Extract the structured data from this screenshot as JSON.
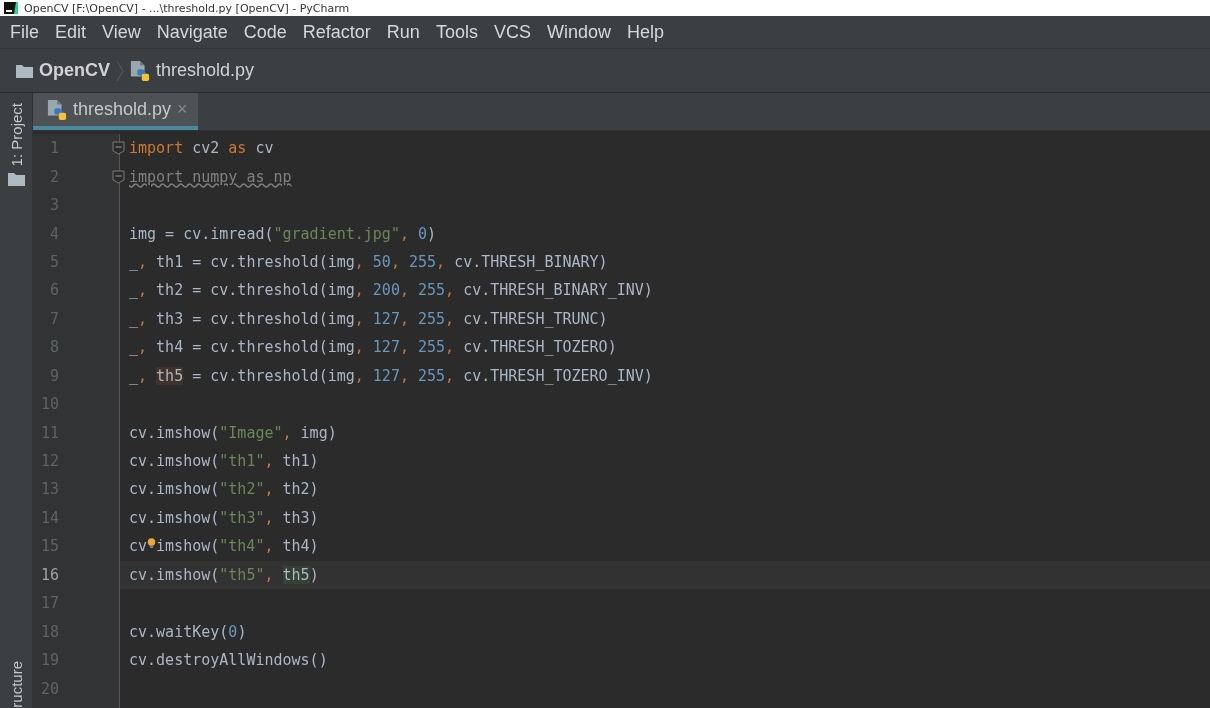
{
  "window": {
    "title": "OpenCV [F:\\OpenCV] - ...\\threshold.py [OpenCV] - PyCharm"
  },
  "menu": [
    {
      "label": "File"
    },
    {
      "label": "Edit"
    },
    {
      "label": "View"
    },
    {
      "label": "Navigate"
    },
    {
      "label": "Code"
    },
    {
      "label": "Refactor"
    },
    {
      "label": "Run"
    },
    {
      "label": "Tools"
    },
    {
      "label": "VCS"
    },
    {
      "label": "Window"
    },
    {
      "label": "Help"
    }
  ],
  "breadcrumb": [
    {
      "label": "OpenCV",
      "kind": "folder"
    },
    {
      "label": "threshold.py",
      "kind": "python"
    }
  ],
  "tabs": [
    {
      "label": "threshold.py",
      "selected": true,
      "close": "×"
    }
  ],
  "side_panels": {
    "top": "1: Project",
    "bottom": "ructure"
  },
  "editor": {
    "lines": [
      {
        "number": "1",
        "fold": true,
        "current": false,
        "tokens": [
          {
            "kind": "kw",
            "text": "import"
          },
          {
            "kind": "plain",
            "text": " cv2 "
          },
          {
            "kind": "kw",
            "text": "as"
          },
          {
            "kind": "plain",
            "text": " cv"
          }
        ]
      },
      {
        "number": "2",
        "fold": true,
        "current": false,
        "tokens": [
          {
            "kind": "unused",
            "text": "import numpy as np"
          }
        ]
      },
      {
        "number": "3",
        "fold": false,
        "current": false
      },
      {
        "number": "4",
        "fold": false,
        "current": false,
        "tokens": [
          {
            "kind": "plain",
            "text": "img = cv.imread("
          },
          {
            "kind": "str",
            "text": "\"gradient.jpg\""
          },
          {
            "kind": "punct",
            "text": ", "
          },
          {
            "kind": "num",
            "text": "0"
          },
          {
            "kind": "plain",
            "text": ")"
          }
        ]
      },
      {
        "number": "5",
        "fold": false,
        "current": false,
        "tokens": [
          {
            "kind": "plain",
            "text": "_"
          },
          {
            "kind": "punct",
            "text": ", "
          },
          {
            "kind": "plain",
            "text": "th1 = cv.threshold(img"
          },
          {
            "kind": "punct",
            "text": ", "
          },
          {
            "kind": "num",
            "text": "50"
          },
          {
            "kind": "punct",
            "text": ", "
          },
          {
            "kind": "num",
            "text": "255"
          },
          {
            "kind": "punct",
            "text": ", "
          },
          {
            "kind": "plain",
            "text": "cv.THRESH_BINARY)"
          }
        ]
      },
      {
        "number": "6",
        "fold": false,
        "current": false,
        "tokens": [
          {
            "kind": "plain",
            "text": "_"
          },
          {
            "kind": "punct",
            "text": ", "
          },
          {
            "kind": "plain",
            "text": "th2 = cv.threshold(img"
          },
          {
            "kind": "punct",
            "text": ", "
          },
          {
            "kind": "num",
            "text": "200"
          },
          {
            "kind": "punct",
            "text": ", "
          },
          {
            "kind": "num",
            "text": "255"
          },
          {
            "kind": "punct",
            "text": ", "
          },
          {
            "kind": "plain",
            "text": "cv.THRESH_BINARY_INV)"
          }
        ]
      },
      {
        "number": "7",
        "fold": false,
        "current": false,
        "tokens": [
          {
            "kind": "plain",
            "text": "_"
          },
          {
            "kind": "punct",
            "text": ", "
          },
          {
            "kind": "plain",
            "text": "th3 = cv.threshold(img"
          },
          {
            "kind": "punct",
            "text": ", "
          },
          {
            "kind": "num",
            "text": "127"
          },
          {
            "kind": "punct",
            "text": ", "
          },
          {
            "kind": "num",
            "text": "255"
          },
          {
            "kind": "punct",
            "text": ", "
          },
          {
            "kind": "plain",
            "text": "cv.THRESH_TRUNC)"
          }
        ]
      },
      {
        "number": "8",
        "fold": false,
        "current": false,
        "tokens": [
          {
            "kind": "plain",
            "text": "_"
          },
          {
            "kind": "punct",
            "text": ", "
          },
          {
            "kind": "plain",
            "text": "th4 = cv.threshold(img"
          },
          {
            "kind": "punct",
            "text": ", "
          },
          {
            "kind": "num",
            "text": "127"
          },
          {
            "kind": "punct",
            "text": ", "
          },
          {
            "kind": "num",
            "text": "255"
          },
          {
            "kind": "punct",
            "text": ", "
          },
          {
            "kind": "plain",
            "text": "cv.THRESH_TOZERO)"
          }
        ]
      },
      {
        "number": "9",
        "fold": false,
        "current": false,
        "tokens": [
          {
            "kind": "plain",
            "text": "_"
          },
          {
            "kind": "punct",
            "text": ", "
          },
          {
            "kind": "write",
            "text": "th5"
          },
          {
            "kind": "plain",
            "text": " = cv.threshold(img"
          },
          {
            "kind": "punct",
            "text": ", "
          },
          {
            "kind": "num",
            "text": "127"
          },
          {
            "kind": "punct",
            "text": ", "
          },
          {
            "kind": "num",
            "text": "255"
          },
          {
            "kind": "punct",
            "text": ", "
          },
          {
            "kind": "plain",
            "text": "cv.THRESH_TOZERO_INV)"
          }
        ]
      },
      {
        "number": "10",
        "fold": false,
        "current": false
      },
      {
        "number": "11",
        "fold": false,
        "current": false,
        "tokens": [
          {
            "kind": "plain",
            "text": "cv.imshow("
          },
          {
            "kind": "str",
            "text": "\"Image\""
          },
          {
            "kind": "punct",
            "text": ", "
          },
          {
            "kind": "plain",
            "text": "img)"
          }
        ]
      },
      {
        "number": "12",
        "fold": false,
        "current": false,
        "tokens": [
          {
            "kind": "plain",
            "text": "cv.imshow("
          },
          {
            "kind": "str",
            "text": "\"th1\""
          },
          {
            "kind": "punct",
            "text": ", "
          },
          {
            "kind": "plain",
            "text": "th1)"
          }
        ]
      },
      {
        "number": "13",
        "fold": false,
        "current": false,
        "tokens": [
          {
            "kind": "plain",
            "text": "cv.imshow("
          },
          {
            "kind": "str",
            "text": "\"th2\""
          },
          {
            "kind": "punct",
            "text": ", "
          },
          {
            "kind": "plain",
            "text": "th2)"
          }
        ]
      },
      {
        "number": "14",
        "fold": false,
        "current": false,
        "tokens": [
          {
            "kind": "plain",
            "text": "cv.imshow("
          },
          {
            "kind": "str",
            "text": "\"th3\""
          },
          {
            "kind": "punct",
            "text": ", "
          },
          {
            "kind": "plain",
            "text": "th3)"
          }
        ]
      },
      {
        "number": "15",
        "fold": false,
        "current": false,
        "tokens": [
          {
            "kind": "plain",
            "text": "cv"
          },
          {
            "kind": "bulb"
          },
          {
            "kind": "plain",
            "text": "imshow("
          },
          {
            "kind": "str",
            "text": "\"th4\""
          },
          {
            "kind": "punct",
            "text": ", "
          },
          {
            "kind": "plain",
            "text": "th4)"
          }
        ]
      },
      {
        "number": "16",
        "fold": false,
        "current": true,
        "tokens": [
          {
            "kind": "plain",
            "text": "cv.imshow("
          },
          {
            "kind": "str",
            "text": "\"th5\""
          },
          {
            "kind": "punct",
            "text": ", "
          },
          {
            "kind": "read",
            "text": "th5"
          },
          {
            "kind": "plain",
            "text": ")"
          }
        ]
      },
      {
        "number": "17",
        "fold": false,
        "current": false
      },
      {
        "number": "18",
        "fold": false,
        "current": false,
        "tokens": [
          {
            "kind": "plain",
            "text": "cv.waitKey("
          },
          {
            "kind": "num",
            "text": "0"
          },
          {
            "kind": "plain",
            "text": ")"
          }
        ]
      },
      {
        "number": "19",
        "fold": false,
        "current": false,
        "tokens": [
          {
            "kind": "plain",
            "text": "cv.destroyAllWindows()"
          }
        ]
      },
      {
        "number": "20",
        "fold": false,
        "current": false
      }
    ]
  }
}
